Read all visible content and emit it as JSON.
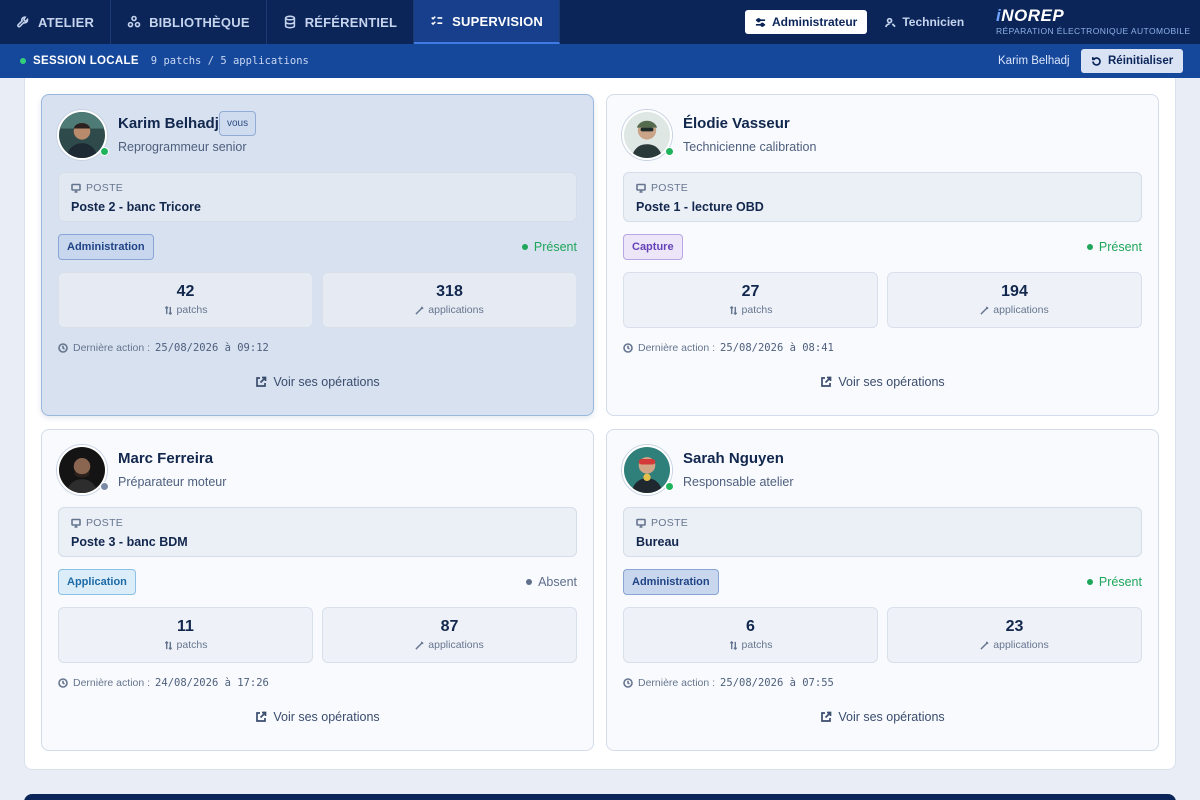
{
  "nav": {
    "tabs": [
      {
        "label": "ATELIER",
        "icon": "wrench-icon",
        "active": false
      },
      {
        "label": "BIBLIOTHÈQUE",
        "icon": "molecule-icon",
        "active": false
      },
      {
        "label": "RÉFÉRENTIEL",
        "icon": "database-icon",
        "active": false
      },
      {
        "label": "SUPERVISION",
        "icon": "checklist-icon",
        "active": true
      }
    ],
    "roles": [
      {
        "label": "Administrateur",
        "icon": "sliders-icon",
        "active": true
      },
      {
        "label": "Technicien",
        "icon": "user-wrench-icon",
        "active": false
      }
    ],
    "brand": {
      "i": "i",
      "name": "NOREP",
      "subtitle": "RÉPARATION ÉLECTRONIQUE AUTOMOBILE"
    }
  },
  "session": {
    "label": "SESSION LOCALE",
    "stats": "9 patchs / 5 applications",
    "user": "Karim Belhadj",
    "reset_label": "Réinitialiser"
  },
  "strings": {
    "poste_label": "POSTE",
    "patchs_label": "patchs",
    "applications_label": "applications",
    "last_action_label": "Dernière action :",
    "ops_label": "Voir ses opérations",
    "you_label": "vous"
  },
  "colors": {
    "present": "#1fa65a",
    "absent": "#5f6f8c",
    "perm_admin_bg": "#c9d7ee",
    "perm_admin_border": "#88a5d6",
    "perm_admin_text": "#1f4385",
    "perm_capture_bg": "#ece6f8",
    "perm_capture_border": "#b9a6e4",
    "perm_capture_text": "#6642b8",
    "perm_app_bg": "#dcedfa",
    "perm_app_border": "#8cc0e6",
    "perm_app_text": "#1c6aa6"
  },
  "users": [
    {
      "name": "Karim Belhadj",
      "role": "Reprogrammeur senior",
      "is_me": true,
      "online": true,
      "poste": "Poste 2 - banc Tricore",
      "permission": "Administration",
      "permission_kind": "admin",
      "presence": "Présent",
      "present": true,
      "patchs": "42",
      "applications": "318",
      "last_action": "25/08/2026 à 09:12"
    },
    {
      "name": "Élodie Vasseur",
      "role": "Technicienne calibration",
      "is_me": false,
      "online": true,
      "poste": "Poste 1 - lecture OBD",
      "permission": "Capture",
      "permission_kind": "capture",
      "presence": "Présent",
      "present": true,
      "patchs": "27",
      "applications": "194",
      "last_action": "25/08/2026 à 08:41"
    },
    {
      "name": "Marc Ferreira",
      "role": "Préparateur moteur",
      "is_me": false,
      "online": false,
      "poste": "Poste 3 - banc BDM",
      "permission": "Application",
      "permission_kind": "app",
      "presence": "Absent",
      "present": false,
      "patchs": "11",
      "applications": "87",
      "last_action": "24/08/2026 à 17:26"
    },
    {
      "name": "Sarah Nguyen",
      "role": "Responsable atelier",
      "is_me": false,
      "online": true,
      "poste": "Bureau",
      "permission": "Administration",
      "permission_kind": "admin",
      "presence": "Présent",
      "present": true,
      "patchs": "6",
      "applications": "23",
      "last_action": "25/08/2026 à 07:55"
    }
  ]
}
